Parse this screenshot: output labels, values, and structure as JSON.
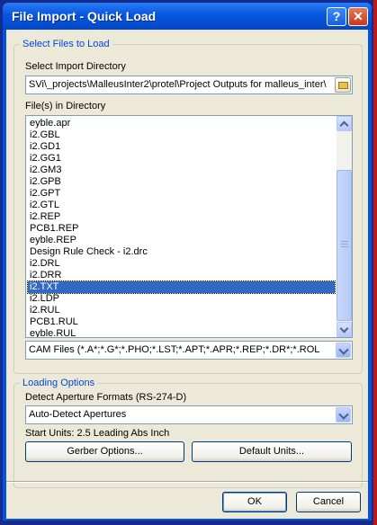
{
  "window": {
    "title": "File Import - Quick Load",
    "help_glyph": "?",
    "close_glyph": "✕"
  },
  "select_files": {
    "legend": "Select Files to Load",
    "dir_label": "Select Import Directory",
    "dir_value": "SVi\\_projects\\MalleusInter2\\protel\\Project Outputs for malleus_inter\\",
    "files_label": "File(s) in Directory",
    "files": [
      "eyble.apr",
      "i2.GBL",
      "i2.GD1",
      "i2.GG1",
      "i2.GM3",
      "i2.GPB",
      "i2.GPT",
      "i2.GTL",
      "i2.REP",
      "PCB1.REP",
      "eyble.REP",
      "Design Rule Check - i2.drc",
      "i2.DRL",
      "i2.DRR",
      "i2.TXT",
      "i2.LDP",
      "i2.RUL",
      "PCB1.RUL",
      "eyble.RUL"
    ],
    "selected_file": "i2.TXT",
    "filter_value": "CAM Files (*.A*;*.G*;*.PHO;*.LST;*.APT;*.APR;*.REP;*.DR*;*.ROL"
  },
  "loading_options": {
    "legend": "Loading Options",
    "aperture_label": "Detect Aperture Formats (RS-274-D)",
    "aperture_value": "Auto-Detect Apertures",
    "start_units": "Start Units: 2.5 Leading Abs Inch",
    "gerber_btn": "Gerber Options...",
    "units_btn": "Default Units..."
  },
  "footer": {
    "ok": "OK",
    "cancel": "Cancel"
  },
  "icons": {
    "folder": "folder-icon",
    "help": "help-icon",
    "close": "close-icon"
  }
}
